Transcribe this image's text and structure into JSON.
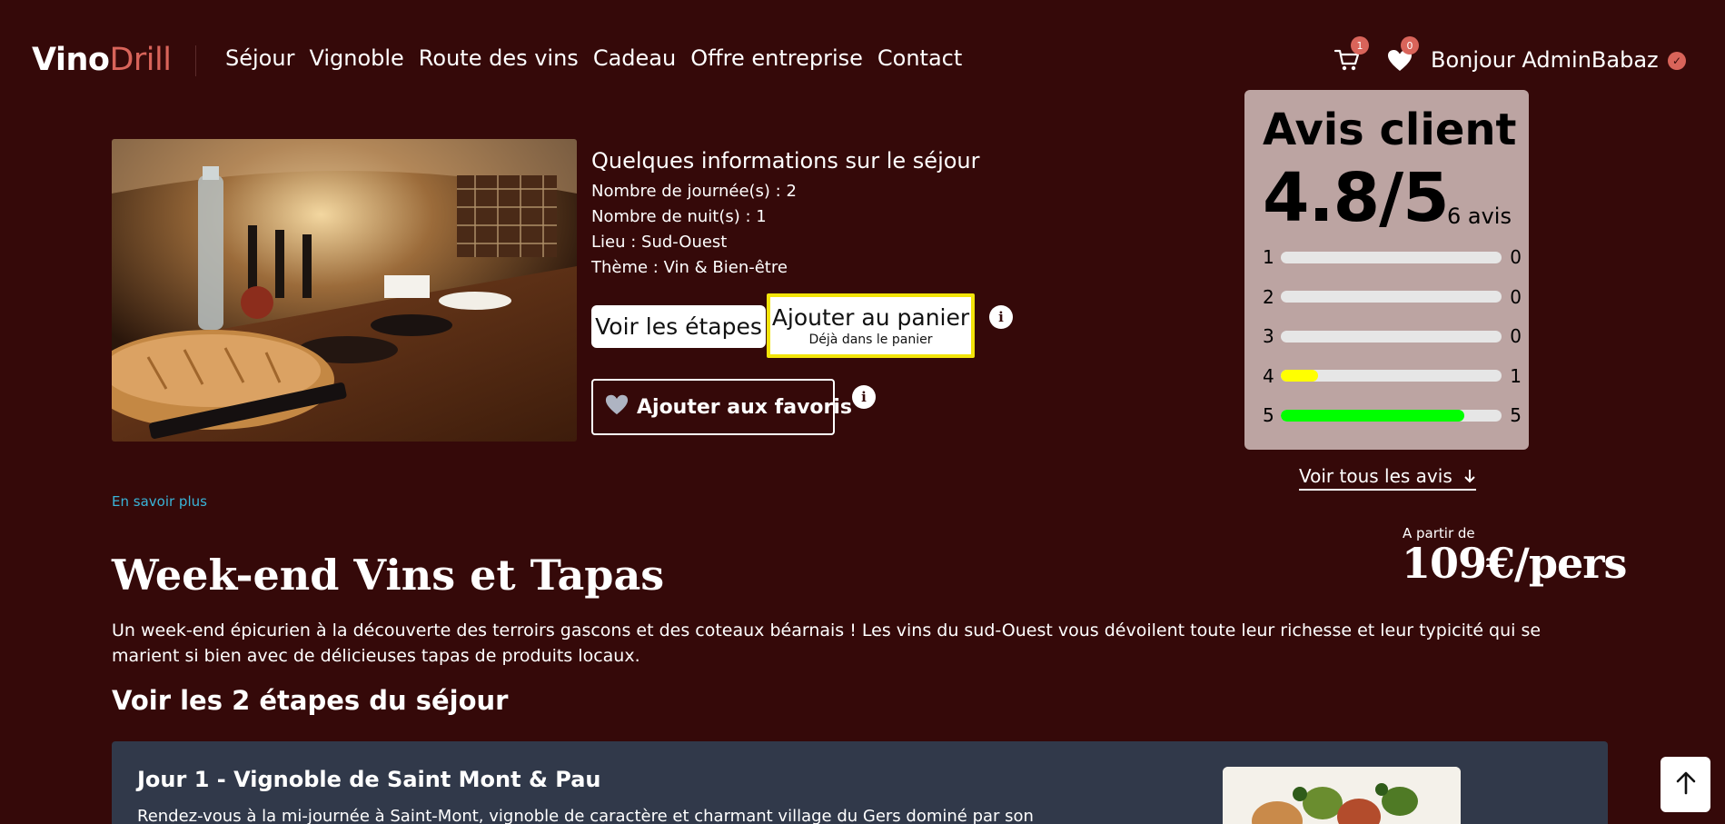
{
  "header": {
    "logo_part1": "Vino",
    "logo_part2": "Drill",
    "nav": [
      "Séjour",
      "Vignoble",
      "Route des vins",
      "Cadeau",
      "Offre entreprise",
      "Contact"
    ],
    "cart_count": "1",
    "favorites_count": "0",
    "greeting": "Bonjour AdminBabaz",
    "icons": [
      "cart-icon",
      "heart-icon",
      "verified-icon"
    ]
  },
  "info": {
    "title": "Quelques informations sur le séjour",
    "lines": [
      "Nombre de journée(s) : 2",
      "Nombre de nuit(s) : 1",
      "Lieu : Sud-Ouest",
      "Thème : Vin & Bien-être"
    ],
    "steps_button": "Voir les étapes",
    "cart_button": "Ajouter au panier",
    "cart_button_sub": "Déjà dans le panier",
    "favorites_button": "Ajouter aux favoris",
    "info_icon": "i"
  },
  "reviews": {
    "title": "Avis client",
    "score": "4.8/5",
    "count": "6 avis",
    "rows": [
      {
        "label": "1",
        "count": "0",
        "fill": 0,
        "color": "#e6e6e6"
      },
      {
        "label": "2",
        "count": "0",
        "fill": 0,
        "color": "#e6e6e6"
      },
      {
        "label": "3",
        "count": "0",
        "fill": 0,
        "color": "#e6e6e6"
      },
      {
        "label": "4",
        "count": "1",
        "fill": 0.167,
        "color": "#ffff00"
      },
      {
        "label": "5",
        "count": "5",
        "fill": 0.833,
        "color": "#00ff00"
      }
    ],
    "see_all": "Voir tous les avis"
  },
  "learn_more": "En savoir plus",
  "price": {
    "label": "A partir de",
    "value": "109€/pers"
  },
  "trip": {
    "title": "Week-end Vins et Tapas",
    "description": "Un week-end épicurien à la découverte des terroirs gascons et des coteaux béarnais ! Les vins du sud-Ouest vous dévoilent toute leur richesse et leur typicité qui se marient si bien avec de délicieuses tapas de produits locaux.",
    "steps_title": "Voir les 2 étapes du séjour"
  },
  "day1": {
    "title": "Jour 1 - Vignoble de Saint Mont & Pau",
    "description": "Rendez-vous à la mi-journée à Saint-Mont, vignoble de caractère et charmant village du Gers dominé par son"
  },
  "colors": {
    "background": "#350909",
    "accent": "#d9645a",
    "highlight_border": "#f2e40a",
    "review_card": "#bca4a2",
    "link": "#39b4d8",
    "day_card": "#31394a"
  }
}
